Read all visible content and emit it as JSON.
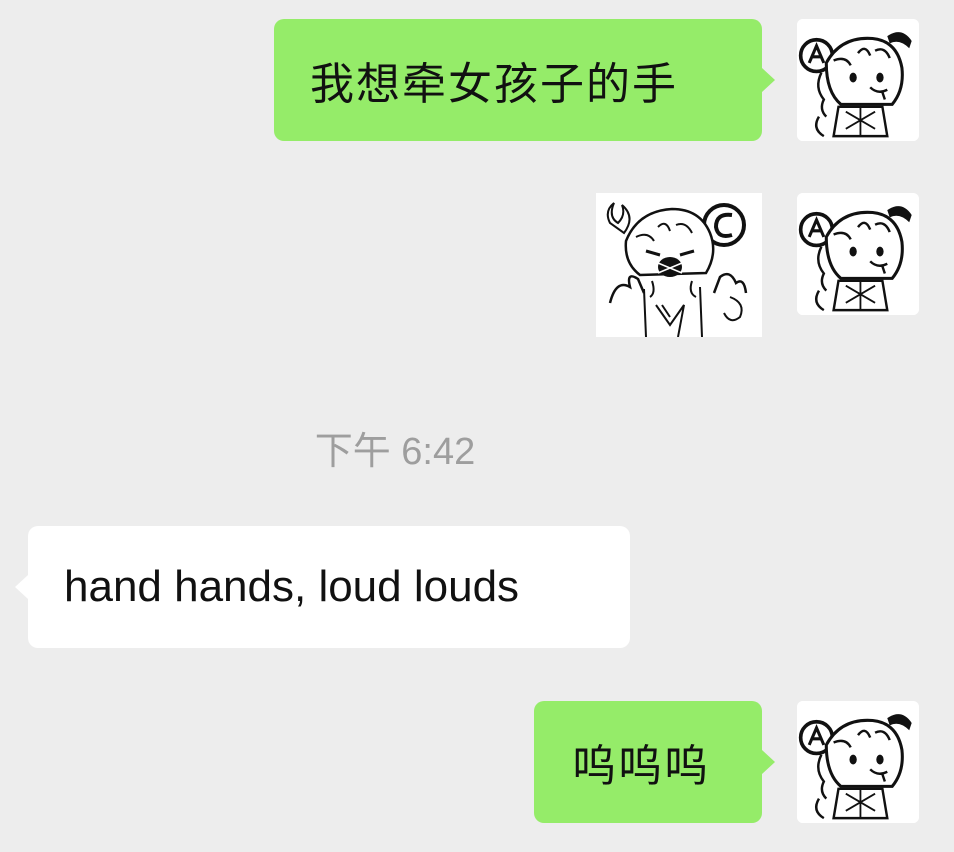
{
  "conversation": {
    "messages": [
      {
        "type": "text",
        "side": "right",
        "text": "我想牵女孩子的手",
        "avatar": "cartoon-girl-avatar"
      },
      {
        "type": "sticker",
        "side": "right",
        "sticker": "angry-cartoon-girl-sticker",
        "avatar": "cartoon-girl-avatar"
      },
      {
        "type": "timestamp",
        "text": "下午 6:42"
      },
      {
        "type": "text",
        "side": "left",
        "text": "hand hands, loud louds"
      },
      {
        "type": "text",
        "side": "right",
        "text": "呜呜呜",
        "avatar": "cartoon-girl-avatar"
      }
    ]
  },
  "colors": {
    "background": "#ededed",
    "sent_bubble": "#95ec69",
    "received_bubble": "#ffffff",
    "timestamp_text": "#9e9e9e"
  }
}
